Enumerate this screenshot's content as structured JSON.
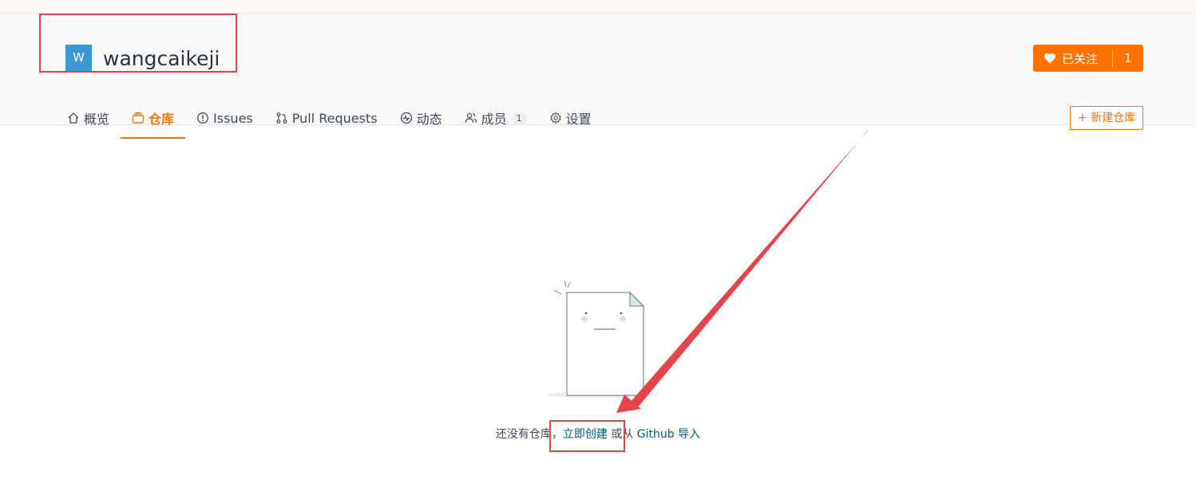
{
  "org": {
    "avatar_letter": "W",
    "name": "wangcaikeji"
  },
  "follow": {
    "label": "已关注",
    "count": "1"
  },
  "nav": {
    "items": [
      {
        "label": "概览",
        "icon": "home-icon"
      },
      {
        "label": "仓库",
        "icon": "repo-icon",
        "active": true
      },
      {
        "label": "Issues",
        "icon": "issue-icon"
      },
      {
        "label": "Pull Requests",
        "icon": "pull-request-icon"
      },
      {
        "label": "动态",
        "icon": "activity-icon"
      },
      {
        "label": "成员",
        "icon": "members-icon",
        "badge": "1"
      },
      {
        "label": "设置",
        "icon": "gear-icon"
      }
    ]
  },
  "new_repo_label": "+ 新建仓库",
  "empty": {
    "prefix": "还没有仓库，",
    "create_link": "立即创建",
    "middle": " 或从 ",
    "github_link": "Github 导入"
  },
  "colors": {
    "accent": "#fe7300",
    "avatar": "#3d97d3",
    "link": "#005980",
    "annotation": "#e8424a"
  }
}
